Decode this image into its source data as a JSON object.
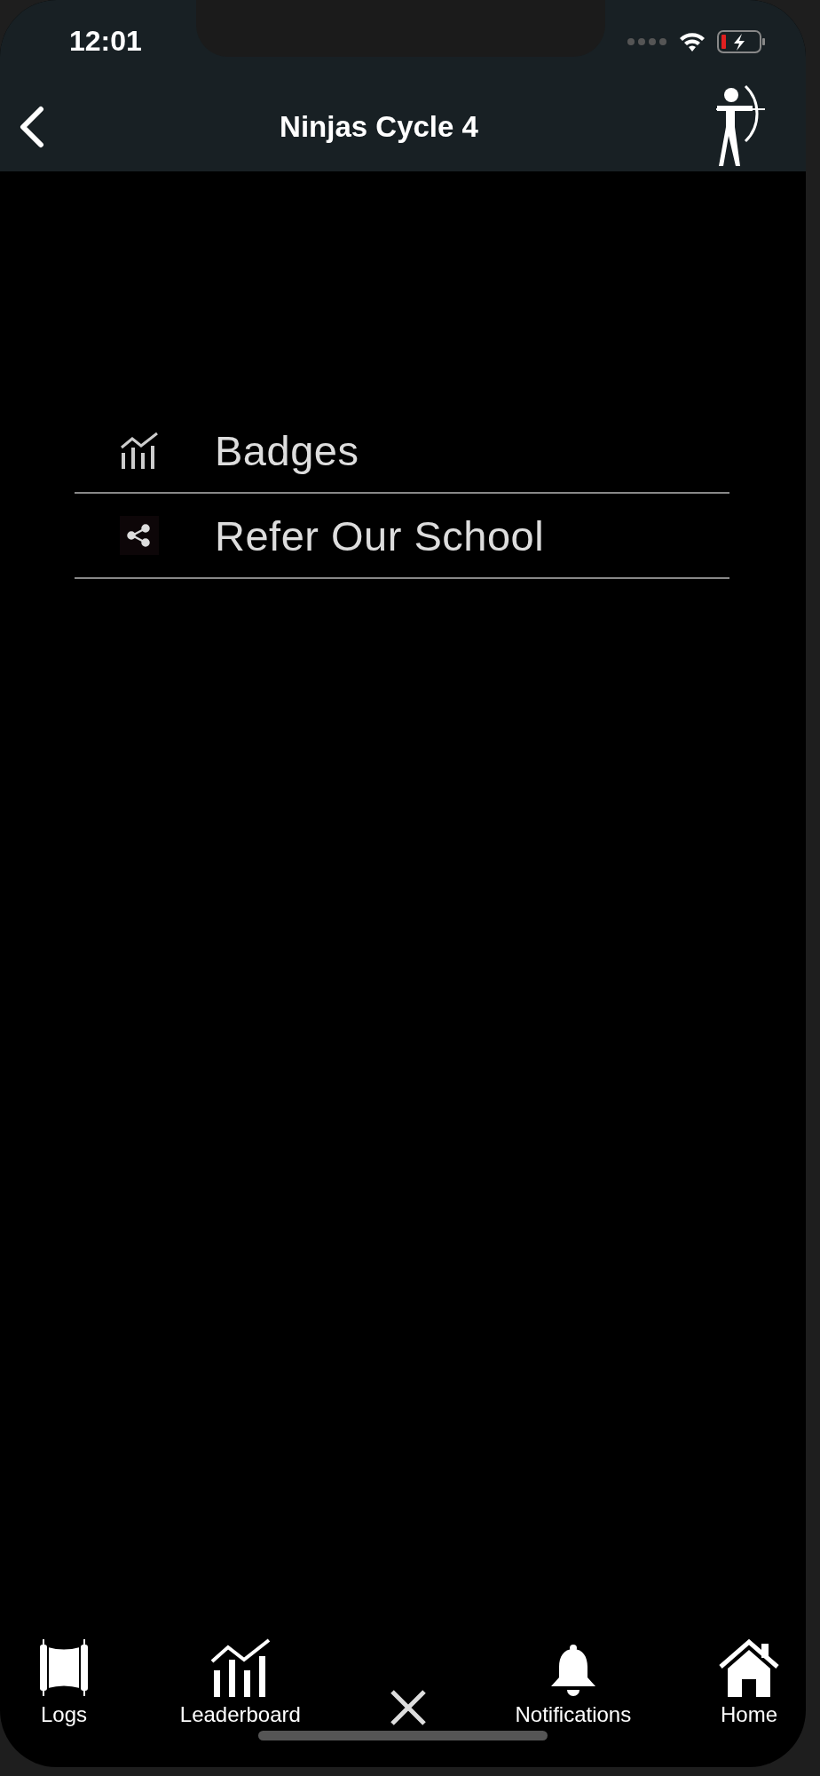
{
  "status_bar": {
    "time": "12:01"
  },
  "header": {
    "title": "Ninjas Cycle 4"
  },
  "menu": [
    {
      "kind": "chart",
      "label": "Badges"
    },
    {
      "kind": "share",
      "label": "Refer Our School"
    }
  ],
  "tab_bar": [
    {
      "kind": "scroll",
      "label": "Logs"
    },
    {
      "kind": "chart",
      "label": "Leaderboard"
    },
    {
      "kind": "close"
    },
    {
      "kind": "bell",
      "label": "Notifications"
    },
    {
      "kind": "home",
      "label": "Home"
    }
  ]
}
